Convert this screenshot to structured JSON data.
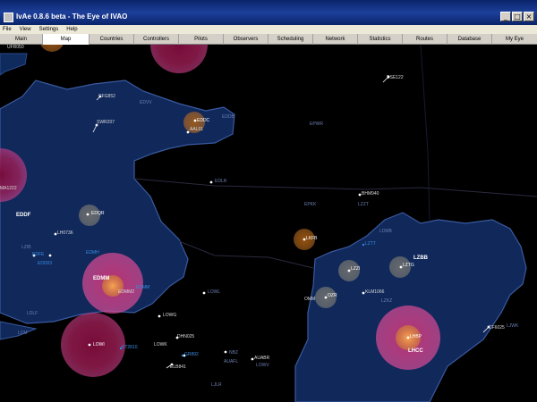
{
  "window": {
    "title": "IvAe 0.8.6 beta - The Eye of IVAO"
  },
  "menu": [
    "File",
    "View",
    "Settings",
    "Help"
  ],
  "tabs": [
    "Main",
    "Map",
    "Countries",
    "Controllers",
    "Pilots",
    "Observers",
    "Scheduling",
    "Network",
    "Statistics",
    "Routes",
    "Database",
    "My Eye"
  ],
  "active_tab": "Map",
  "map_labels": {
    "ufr050": "UFR050",
    "cfg852": "CFG852",
    "swr207": "SWR207",
    "eddc": "EDDC",
    "aal01": "AAL01",
    "eddb": "EDDB",
    "epwr": "EPWR",
    "dse122": "DSE122",
    "eddf": "EDDF",
    "ma1222": "MA1222",
    "edfe": "EDFE",
    "edqr": "EDQR",
    "edd03": "EDD03",
    "edlr": "EDLR",
    "lh0736": "LH0736",
    "edmm": "EDMM",
    "edmm_tag": "EDMM",
    "edmm2": "EDMM2",
    "edmh": "EDMH",
    "lzib": "LZIB",
    "epkk": "EPKK",
    "bhm940": "BHM940",
    "lzzt": "LZZT",
    "lztt": "LZTT",
    "lkfb": "LKFB",
    "ldmb": "LDMB",
    "lzbb": "LZBB",
    "lzzi": "LZZI",
    "lztg": "LZTG",
    "ozr": "OZR",
    "omm": "OMM",
    "lohr": "LOHR",
    "klm1066": "KLM1066",
    "lzkz": "LZKZ",
    "lowl": "LOWL",
    "lowg": "LOWG",
    "dhn025": "DHN025",
    "lowi": "LOWI",
    "lowk": "LOWK",
    "nbz": "NBZ",
    "lowv": "LOWV",
    "kt2810": "KT2810",
    "gr892": "GR892",
    "ljlr": "LJLR",
    "auabr": "AUABR",
    "auafl": "AUAFL",
    "elb841": "ELB841",
    "lhbp": "LHBP",
    "lhcc": "LHCC",
    "cf6025": "CF6025",
    "ljwk": "LJWK",
    "lcm": "LCM",
    "ldlf": "LDLF",
    "hs1": "EDVV"
  }
}
